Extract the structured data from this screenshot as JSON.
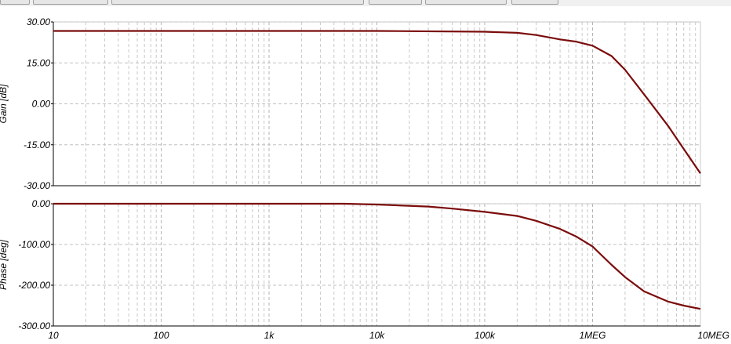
{
  "chart_data": [
    {
      "type": "line",
      "panel": "gain",
      "ylabel": "Gain [dB]",
      "x_scale": "log",
      "xlim": [
        10,
        10000000
      ],
      "ylim": [
        -30,
        30
      ],
      "yticks": [
        "30.00",
        "15.00",
        "0.00",
        "-15.00",
        "-30.00"
      ],
      "ytick_values": [
        30,
        15,
        0,
        -15,
        -30
      ],
      "grid": true,
      "color": "#7b0c0c",
      "series": [
        {
          "x": [
            10,
            10000,
            100000,
            200000,
            300000,
            500000,
            700000,
            1000000,
            1500000,
            2000000,
            3000000,
            5000000,
            7000000,
            10000000
          ],
          "values": [
            26.7,
            26.7,
            26.4,
            26.0,
            25.2,
            23.6,
            22.8,
            21.3,
            17.5,
            12.5,
            3.5,
            -8.0,
            -16.5,
            -25.5
          ]
        }
      ]
    },
    {
      "type": "line",
      "panel": "phase",
      "ylabel": "Phase [deg]",
      "x_scale": "log",
      "xlim": [
        10,
        10000000
      ],
      "ylim": [
        -300,
        0
      ],
      "yticks": [
        "0.00",
        "-100.00",
        "-200.00",
        "-300.00"
      ],
      "ytick_values": [
        0,
        -100,
        -200,
        -300
      ],
      "xticks": [
        "10",
        "100",
        "1k",
        "10k",
        "100k",
        "1MEG",
        "10MEG"
      ],
      "xtick_values": [
        10,
        100,
        1000,
        10000,
        100000,
        1000000,
        10000000
      ],
      "grid": true,
      "color": "#7b0c0c",
      "series": [
        {
          "x": [
            10,
            5000,
            10000,
            30000,
            50000,
            100000,
            200000,
            300000,
            500000,
            700000,
            1000000,
            1500000,
            2000000,
            3000000,
            5000000,
            7000000,
            10000000
          ],
          "values": [
            0,
            0,
            -2,
            -7,
            -12,
            -20,
            -30,
            -42,
            -62,
            -80,
            -105,
            -150,
            -180,
            -215,
            -240,
            -250,
            -258
          ]
        }
      ]
    }
  ]
}
